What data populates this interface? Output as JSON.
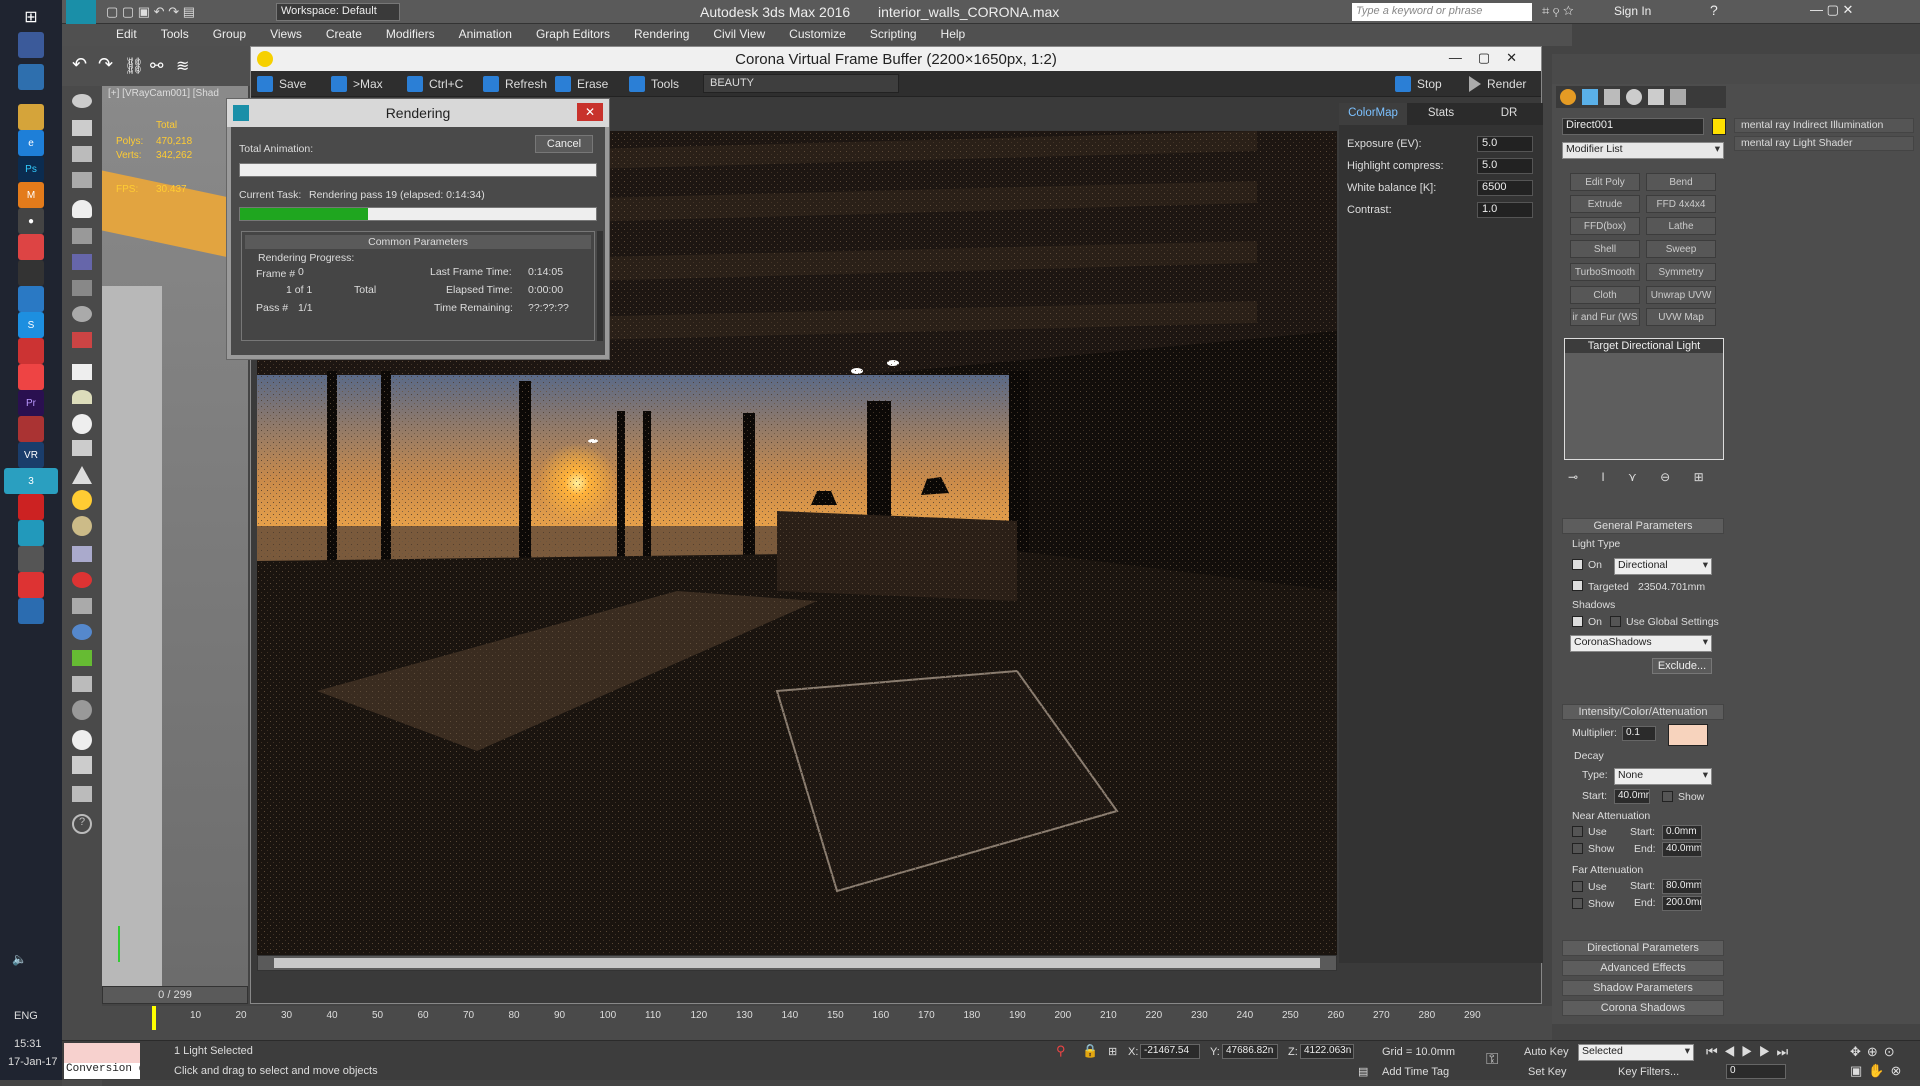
{
  "titlebar": {
    "app_title": "Autodesk 3ds Max 2016",
    "file": "interior_walls_CORONA.max",
    "workspace": "Workspace: Default",
    "search_placeholder": "Type a keyword or phrase",
    "sign_in": "Sign In"
  },
  "menu": [
    "Edit",
    "Tools",
    "Group",
    "Views",
    "Create",
    "Modifiers",
    "Animation",
    "Graph Editors",
    "Rendering",
    "Civil View",
    "Customize",
    "Scripting",
    "Help"
  ],
  "viewport": {
    "label": "[+] [VRayCam001] [Shad",
    "polys_label": "Polys:",
    "polys_value": "470,218",
    "verts_label": "Verts:",
    "verts_value": "342,262",
    "total_label": "Total",
    "fps_label": "FPS:",
    "fps_value": "30.437",
    "frame_counter": "0 / 299"
  },
  "vfb": {
    "title": "Corona Virtual Frame Buffer (2200×1650px, 1:2)",
    "save": "Save",
    "to_max": ">Max",
    "copy": "Ctrl+C",
    "refresh": "Refresh",
    "erase": "Erase",
    "tools": "Tools",
    "pass": "BEAUTY",
    "stop": "Stop",
    "render": "Render",
    "tabs": [
      "ColorMap",
      "Stats",
      "DR"
    ],
    "colormap": [
      {
        "label": "Exposure (EV):",
        "value": "5.0"
      },
      {
        "label": "Highlight compress:",
        "value": "5.0"
      },
      {
        "label": "White balance [K]:",
        "value": "6500"
      },
      {
        "label": "Contrast:",
        "value": "1.0"
      }
    ]
  },
  "dialog": {
    "title": "Rendering",
    "cancel": "Cancel",
    "total_animation": "Total Animation:",
    "current_task_label": "Current Task:",
    "current_task": "Rendering pass 19 (elapsed: 0:14:34)",
    "task_progress": 0.36,
    "animation_progress": 0.0,
    "common_parameters": "Common Parameters",
    "rendering_progress": "Rendering Progress:",
    "frame_label": "Frame #",
    "frame_value": "0",
    "of_label": "1 of 1",
    "total_label": "Total",
    "pass_label": "Pass #",
    "pass_value": "1/1",
    "last_frame_time_label": "Last Frame Time:",
    "last_frame_time": "0:14:05",
    "elapsed_label": "Elapsed Time:",
    "elapsed": "0:00:00",
    "remaining_label": "Time Remaining:",
    "remaining": "??:??:??"
  },
  "cmdpanel": {
    "object_name": "Direct001",
    "modifier_list": "Modifier List",
    "modifiers": [
      "Edit Poly",
      "Bend",
      "Extrude",
      "FFD 4x4x4",
      "FFD(box)",
      "Lathe",
      "Shell",
      "Sweep",
      "TurboSmooth",
      "Symmetry",
      "Cloth",
      "Unwrap UVW",
      "ir and Fur (WS",
      "UVW Map"
    ],
    "stack_item": "Target Directional Light",
    "rollouts_side": [
      "mental ray Indirect Illumination",
      "mental ray Light Shader"
    ],
    "general": {
      "title": "General Parameters",
      "light_type": "Light Type",
      "on": "On",
      "type": "Directional",
      "targeted": "Targeted",
      "target_dist": "23504.701mm",
      "shadows": "Shadows",
      "use_global": "Use Global Settings",
      "shadow_type": "CoronaShadows",
      "exclude": "Exclude..."
    },
    "intensity": {
      "title": "Intensity/Color/Attenuation",
      "multiplier_label": "Multiplier:",
      "multiplier": "0.1",
      "color": "#f7d3bd",
      "decay": "Decay",
      "type_label": "Type:",
      "type": "None",
      "start_label": "Start:",
      "start": "40.0mr",
      "show": "Show",
      "near": "Near Attenuation",
      "use": "Use",
      "near_start": "0.0mm",
      "near_end": "40.0mm",
      "far": "Far Attenuation",
      "far_start": "80.0mm",
      "far_end": "200.0mr",
      "end_label": "End:"
    },
    "collapsed": [
      "Directional Parameters",
      "Advanced Effects",
      "Shadow Parameters",
      "Corona Shadows"
    ]
  },
  "timeline": {
    "ticks": [
      "10",
      "20",
      "30",
      "40",
      "50",
      "60",
      "70",
      "80",
      "90",
      "100",
      "110",
      "120",
      "130",
      "140",
      "150",
      "160",
      "170",
      "180",
      "190",
      "200",
      "210",
      "220",
      "230",
      "240",
      "250",
      "260",
      "270",
      "280",
      "290"
    ]
  },
  "status": {
    "selected": "1 Light Selected",
    "hint": "Click and drag to select and move objects",
    "x_label": "X:",
    "x": "-21467.54",
    "y_label": "Y:",
    "y": "47686.82n",
    "z_label": "Z:",
    "z": "4122.063n",
    "grid": "Grid = 10.0mm",
    "add_time_tag": "Add Time Tag",
    "auto_key": "Auto Key",
    "set_key": "Set Key",
    "selected_dd": "Selected",
    "key_filters": "Key Filters...",
    "frame": "0",
    "conversion": "Conversion d"
  },
  "clock": {
    "lang": "ENG",
    "time": "15:31",
    "date": "17-Jan-17"
  }
}
